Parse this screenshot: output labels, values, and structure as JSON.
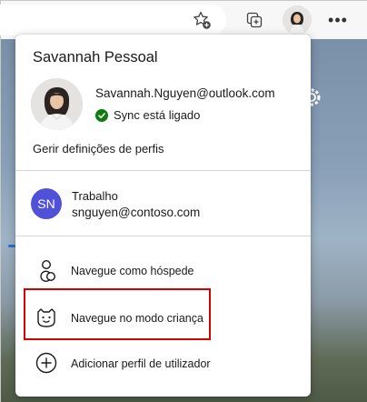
{
  "profile": {
    "name": "Savannah Pessoal",
    "email": "Savannah.Nguyen@outlook.com",
    "sync_status": "Sync está ligado",
    "manage_link": "Gerir definições de perfis"
  },
  "other_profile": {
    "initials": "SN",
    "name": "Trabalho",
    "email": "snguyen@contoso.com"
  },
  "actions": {
    "guest": "Navegue como hóspede",
    "kids": "Navegue no modo criança",
    "add": "Adicionar perfil de utilizador"
  },
  "icons": {
    "favorite": "star-add-icon",
    "collections": "collections-icon",
    "more": "more-icon",
    "sync": "check-circle-icon",
    "guest": "guest-icon",
    "kids": "kids-face-icon",
    "add": "add-circle-icon",
    "gear": "gear-icon"
  },
  "colors": {
    "sync_check": "#107c10",
    "sn_avatar": "#4f52d8",
    "highlight": "#d60000"
  }
}
